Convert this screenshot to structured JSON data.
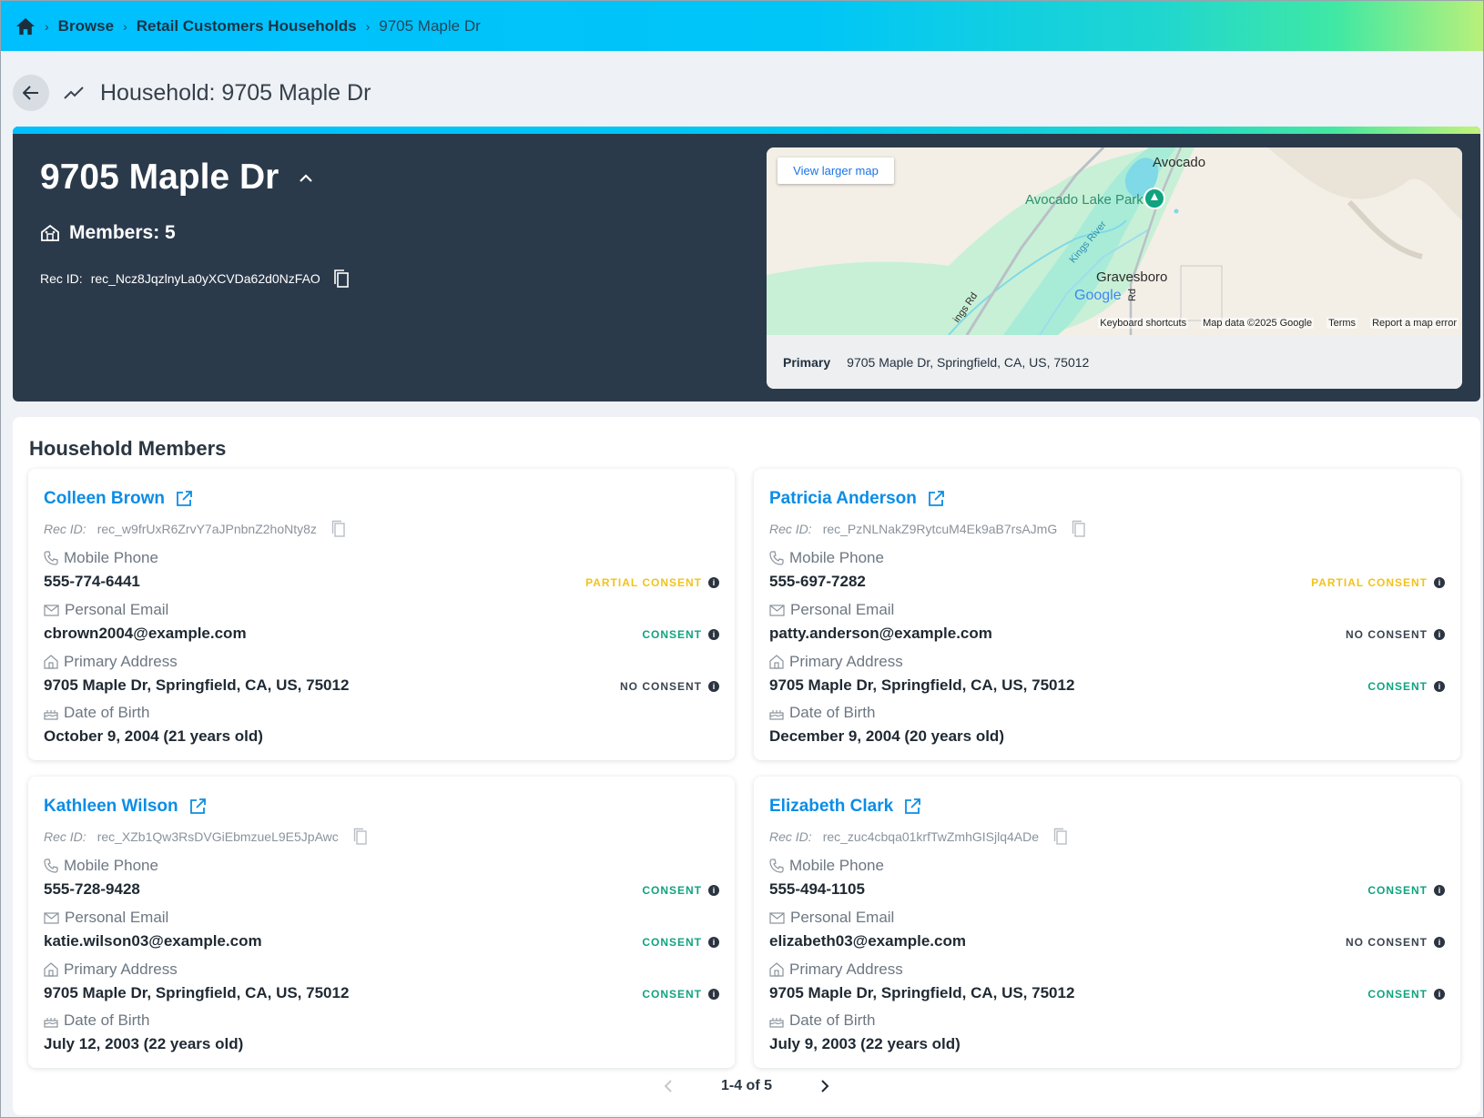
{
  "breadcrumb": {
    "items": [
      {
        "label": "Browse"
      },
      {
        "label": "Retail Customers Households"
      }
    ],
    "current": "9705 Maple Dr"
  },
  "header": {
    "title": "Household: 9705 Maple Dr"
  },
  "household": {
    "name": "9705 Maple Dr",
    "members_label": "Members: 5",
    "rec_label": "Rec ID:",
    "rec_id": "rec_Ncz8JqzlnyLa0yXCVDa62d0NzFAO"
  },
  "map": {
    "view_larger": "View larger map",
    "places": [
      "Avocado",
      "Avocado Lake Park",
      "Kings River",
      "Gravesboro",
      "Rd",
      "ings Rd"
    ],
    "google": "Google",
    "footer": [
      "Keyboard shortcuts",
      "Map data ©2025 Google",
      "Terms",
      "Report a map error"
    ],
    "address_label": "Primary",
    "address": "9705 Maple Dr, Springfield, CA, US, 75012"
  },
  "members_panel": {
    "title": "Household Members",
    "rec_label": "Rec ID:",
    "labels": {
      "phone": "Mobile Phone",
      "email": "Personal Email",
      "address": "Primary Address",
      "dob": "Date of Birth"
    },
    "members": [
      {
        "name": "Colleen Brown",
        "rec_id": "rec_w9frUxR6ZrvY7aJPnbnZ2hoNty8z",
        "phone": "555-774-6441",
        "phone_consent": "PARTIAL CONSENT",
        "email": "cbrown2004@example.com",
        "email_consent": "CONSENT",
        "address": "9705 Maple Dr, Springfield, CA, US, 75012",
        "address_consent": "NO CONSENT",
        "dob": "October 9, 2004 (21 years old)"
      },
      {
        "name": "Patricia Anderson",
        "rec_id": "rec_PzNLNakZ9RytcuM4Ek9aB7rsAJmG",
        "phone": "555-697-7282",
        "phone_consent": "PARTIAL CONSENT",
        "email": "patty.anderson@example.com",
        "email_consent": "NO CONSENT",
        "address": "9705 Maple Dr, Springfield, CA, US, 75012",
        "address_consent": "CONSENT",
        "dob": "December 9, 2004 (20 years old)"
      },
      {
        "name": "Kathleen Wilson",
        "rec_id": "rec_XZb1Qw3RsDVGiEbmzueL9E5JpAwc",
        "phone": "555-728-9428",
        "phone_consent": "CONSENT",
        "email": "katie.wilson03@example.com",
        "email_consent": "CONSENT",
        "address": "9705 Maple Dr, Springfield, CA, US, 75012",
        "address_consent": "CONSENT",
        "dob": "July 12, 2003 (22 years old)"
      },
      {
        "name": "Elizabeth Clark",
        "rec_id": "rec_zuc4cbqa01krfTwZmhGISjlq4ADe",
        "phone": "555-494-1105",
        "phone_consent": "CONSENT",
        "email": "elizabeth03@example.com",
        "email_consent": "NO CONSENT",
        "address": "9705 Maple Dr, Springfield, CA, US, 75012",
        "address_consent": "CONSENT",
        "dob": "July 9, 2003 (22 years old)"
      }
    ],
    "pagination": "1-4 of 5"
  },
  "colors": {
    "accent": "#0b8de6",
    "partial": "#f2c21b",
    "consent": "#10a37f",
    "no_consent": "#3a444f",
    "hero_bg": "#2b3a4b"
  },
  "icons": [
    "home-icon",
    "back-arrow-icon",
    "trend-icon",
    "chevron-up-icon",
    "house-icon",
    "copy-icon",
    "external-link-icon",
    "phone-icon",
    "mail-icon",
    "home-outline-icon",
    "cake-icon",
    "info-icon",
    "chevron-left-icon",
    "chevron-right-icon"
  ]
}
